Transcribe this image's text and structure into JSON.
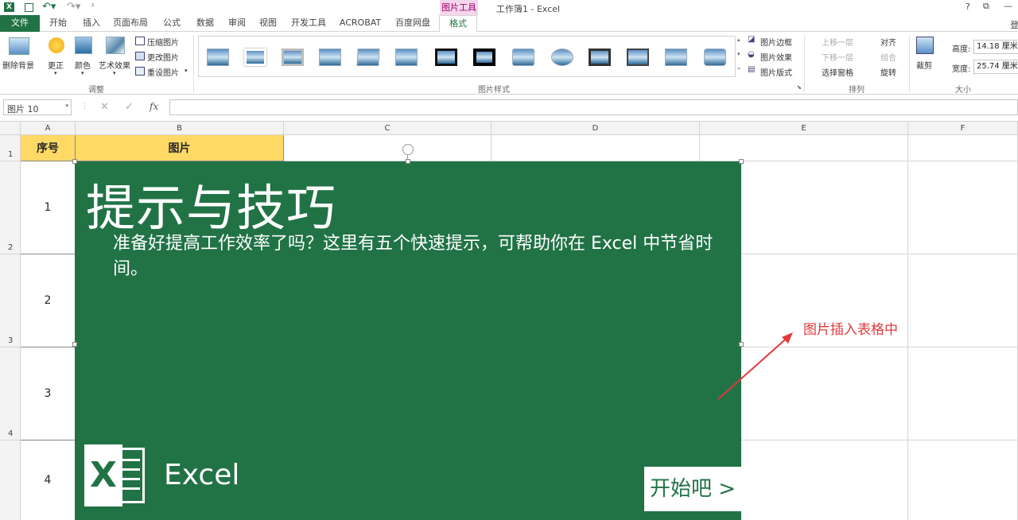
{
  "window": {
    "title": "工作簿1 - Excel",
    "context_tab_group": "图片工具",
    "help": "?",
    "restore": "⧉",
    "minimize": "—",
    "signin_partial": "登"
  },
  "tabs": [
    "文件",
    "开始",
    "插入",
    "页面布局",
    "公式",
    "数据",
    "审阅",
    "视图",
    "开发工具",
    "ACROBAT",
    "百度网盘",
    "格式"
  ],
  "ribbon": {
    "adjust": {
      "remove_bg": "删除背景",
      "corrections": "更正",
      "color": "颜色",
      "artistic": "艺术效果",
      "compress": "压缩图片",
      "change": "更改图片",
      "reset": "重设图片",
      "label": "调整"
    },
    "styles": {
      "label": "图片样式",
      "border": "图片边框",
      "effects": "图片效果",
      "layout": "图片版式"
    },
    "arrange": {
      "bring_forward": "上移一层",
      "send_backward": "下移一层",
      "selection_pane": "选择窗格",
      "align": "对齐",
      "group": "组合",
      "rotate": "旋转",
      "label": "排列"
    },
    "size": {
      "crop": "裁剪",
      "height_label": "高度:",
      "height": "14.18 厘米",
      "width_label": "宽度:",
      "width": "25.74 厘米",
      "label": "大小"
    }
  },
  "formula_bar": {
    "name_box": "图片 10",
    "fx": "fx",
    "cancel": "✕",
    "enter": "✓",
    "value": ""
  },
  "columns": [
    "A",
    "B",
    "C",
    "D",
    "E",
    "F"
  ],
  "rows": [
    "1",
    "2",
    "3",
    "4"
  ],
  "cells": {
    "a1": "序号",
    "b1": "图片",
    "a2": "1",
    "a3": "2",
    "a4": "3",
    "a5": "4"
  },
  "picture": {
    "title": "提示与技巧",
    "body": "准备好提高工作效率了吗？这里有五个快速提示，可帮助你在 Excel 中节省时间。",
    "brand": "Excel",
    "start": "开始吧 >"
  },
  "annotation": {
    "text": "图片插入表格中",
    "color": "#e0393e"
  },
  "colors": {
    "accent": "#217346",
    "header_fill": "#ffd966"
  }
}
